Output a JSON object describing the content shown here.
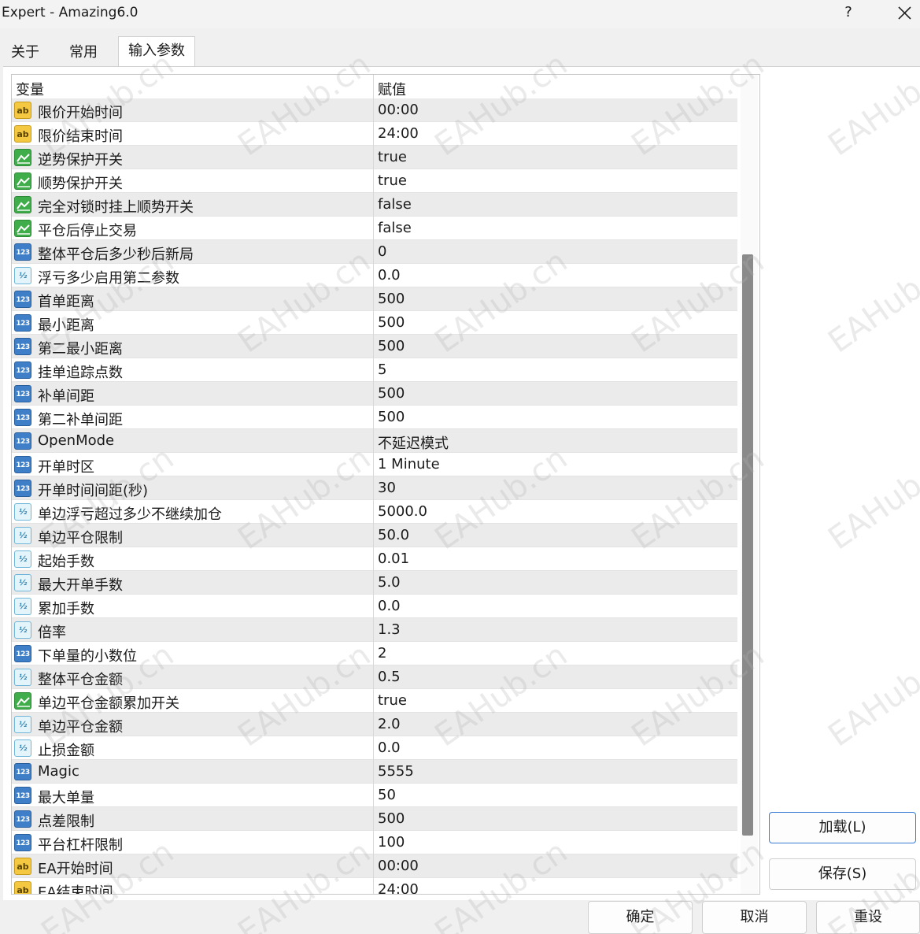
{
  "window": {
    "title": "Expert - Amazing6.0",
    "help_label": "?"
  },
  "tabs": [
    {
      "label": "关于",
      "active": false
    },
    {
      "label": "常用",
      "active": false
    },
    {
      "label": "输入参数",
      "active": true
    }
  ],
  "grid": {
    "headers": {
      "variable": "变量",
      "value": "赋值"
    },
    "rows": [
      {
        "icon": "ab",
        "name": "限价开始时间",
        "value": "00:00"
      },
      {
        "icon": "ab",
        "name": "限价结束时间",
        "value": "24:00"
      },
      {
        "icon": "bool",
        "name": "逆势保护开关",
        "value": "true"
      },
      {
        "icon": "bool",
        "name": "顺势保护开关",
        "value": "true"
      },
      {
        "icon": "bool",
        "name": "完全对锁时挂上顺势开关",
        "value": "false"
      },
      {
        "icon": "bool",
        "name": "平仓后停止交易",
        "value": "false"
      },
      {
        "icon": "123",
        "name": "整体平仓后多少秒后新局",
        "value": "0"
      },
      {
        "icon": "v2",
        "name": "浮亏多少启用第二参数",
        "value": "0.0"
      },
      {
        "icon": "123",
        "name": "首单距离",
        "value": "500"
      },
      {
        "icon": "123",
        "name": "最小距离",
        "value": "500"
      },
      {
        "icon": "123",
        "name": "第二最小距离",
        "value": "500"
      },
      {
        "icon": "123",
        "name": "挂单追踪点数",
        "value": "5"
      },
      {
        "icon": "123",
        "name": "补单间距",
        "value": "500"
      },
      {
        "icon": "123",
        "name": "第二补单间距",
        "value": "500"
      },
      {
        "icon": "123",
        "name": "OpenMode",
        "value": "不延迟模式"
      },
      {
        "icon": "123",
        "name": "开单时区",
        "value": "1 Minute"
      },
      {
        "icon": "123",
        "name": "开单时间间距(秒)",
        "value": "30"
      },
      {
        "icon": "v2",
        "name": "单边浮亏超过多少不继续加仓",
        "value": "5000.0"
      },
      {
        "icon": "v2",
        "name": "单边平仓限制",
        "value": "50.0"
      },
      {
        "icon": "v2",
        "name": "起始手数",
        "value": "0.01"
      },
      {
        "icon": "v2",
        "name": "最大开单手数",
        "value": "5.0"
      },
      {
        "icon": "v2",
        "name": "累加手数",
        "value": "0.0"
      },
      {
        "icon": "v2",
        "name": "倍率",
        "value": "1.3"
      },
      {
        "icon": "123",
        "name": "下单量的小数位",
        "value": "2"
      },
      {
        "icon": "v2",
        "name": "整体平仓金额",
        "value": "0.5"
      },
      {
        "icon": "bool",
        "name": "单边平仓金额累加开关",
        "value": "true"
      },
      {
        "icon": "v2",
        "name": "单边平仓金额",
        "value": "2.0"
      },
      {
        "icon": "v2",
        "name": "止损金额",
        "value": "0.0"
      },
      {
        "icon": "123",
        "name": "Magic",
        "value": "5555"
      },
      {
        "icon": "123",
        "name": "最大单量",
        "value": "50"
      },
      {
        "icon": "123",
        "name": "点差限制",
        "value": "500"
      },
      {
        "icon": "123",
        "name": "平台杠杆限制",
        "value": "100"
      },
      {
        "icon": "ab",
        "name": "EA开始时间",
        "value": "00:00"
      },
      {
        "icon": "ab",
        "name": "EA结束时间",
        "value": "24:00"
      }
    ]
  },
  "side_buttons": {
    "load": "加载(L)",
    "save": "保存(S)"
  },
  "footer_buttons": {
    "ok": "确定",
    "cancel": "取消",
    "reset": "重设"
  },
  "watermark": "EAHub.cn",
  "icon_text": {
    "ab": "ab",
    "123": "123",
    "v2": "½"
  }
}
